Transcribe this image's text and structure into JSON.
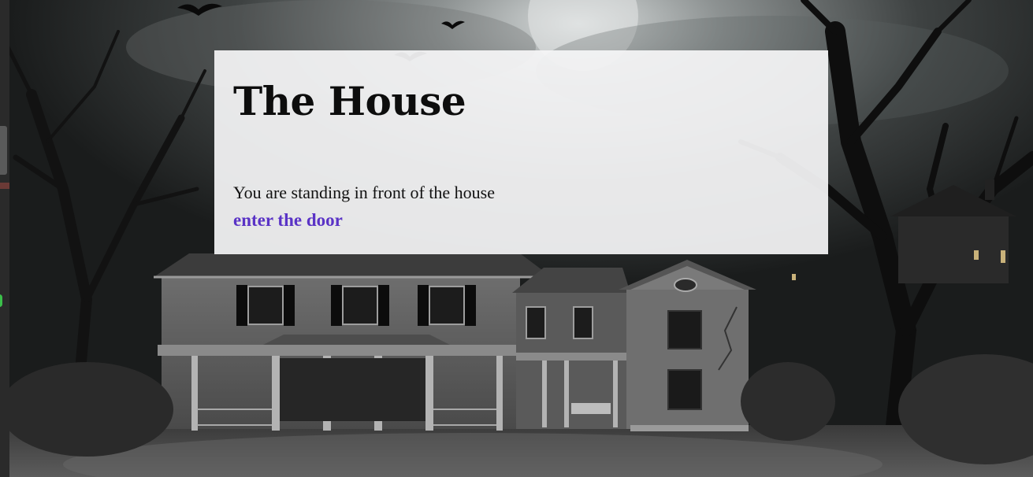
{
  "story": {
    "title": "The House",
    "description": "You are standing in front of the house",
    "choices": [
      {
        "label": "enter the door"
      }
    ]
  },
  "colors": {
    "card_background": "#f5f5f6",
    "title_color": "#0d0d0d",
    "choice_link": "#5a33c6"
  }
}
